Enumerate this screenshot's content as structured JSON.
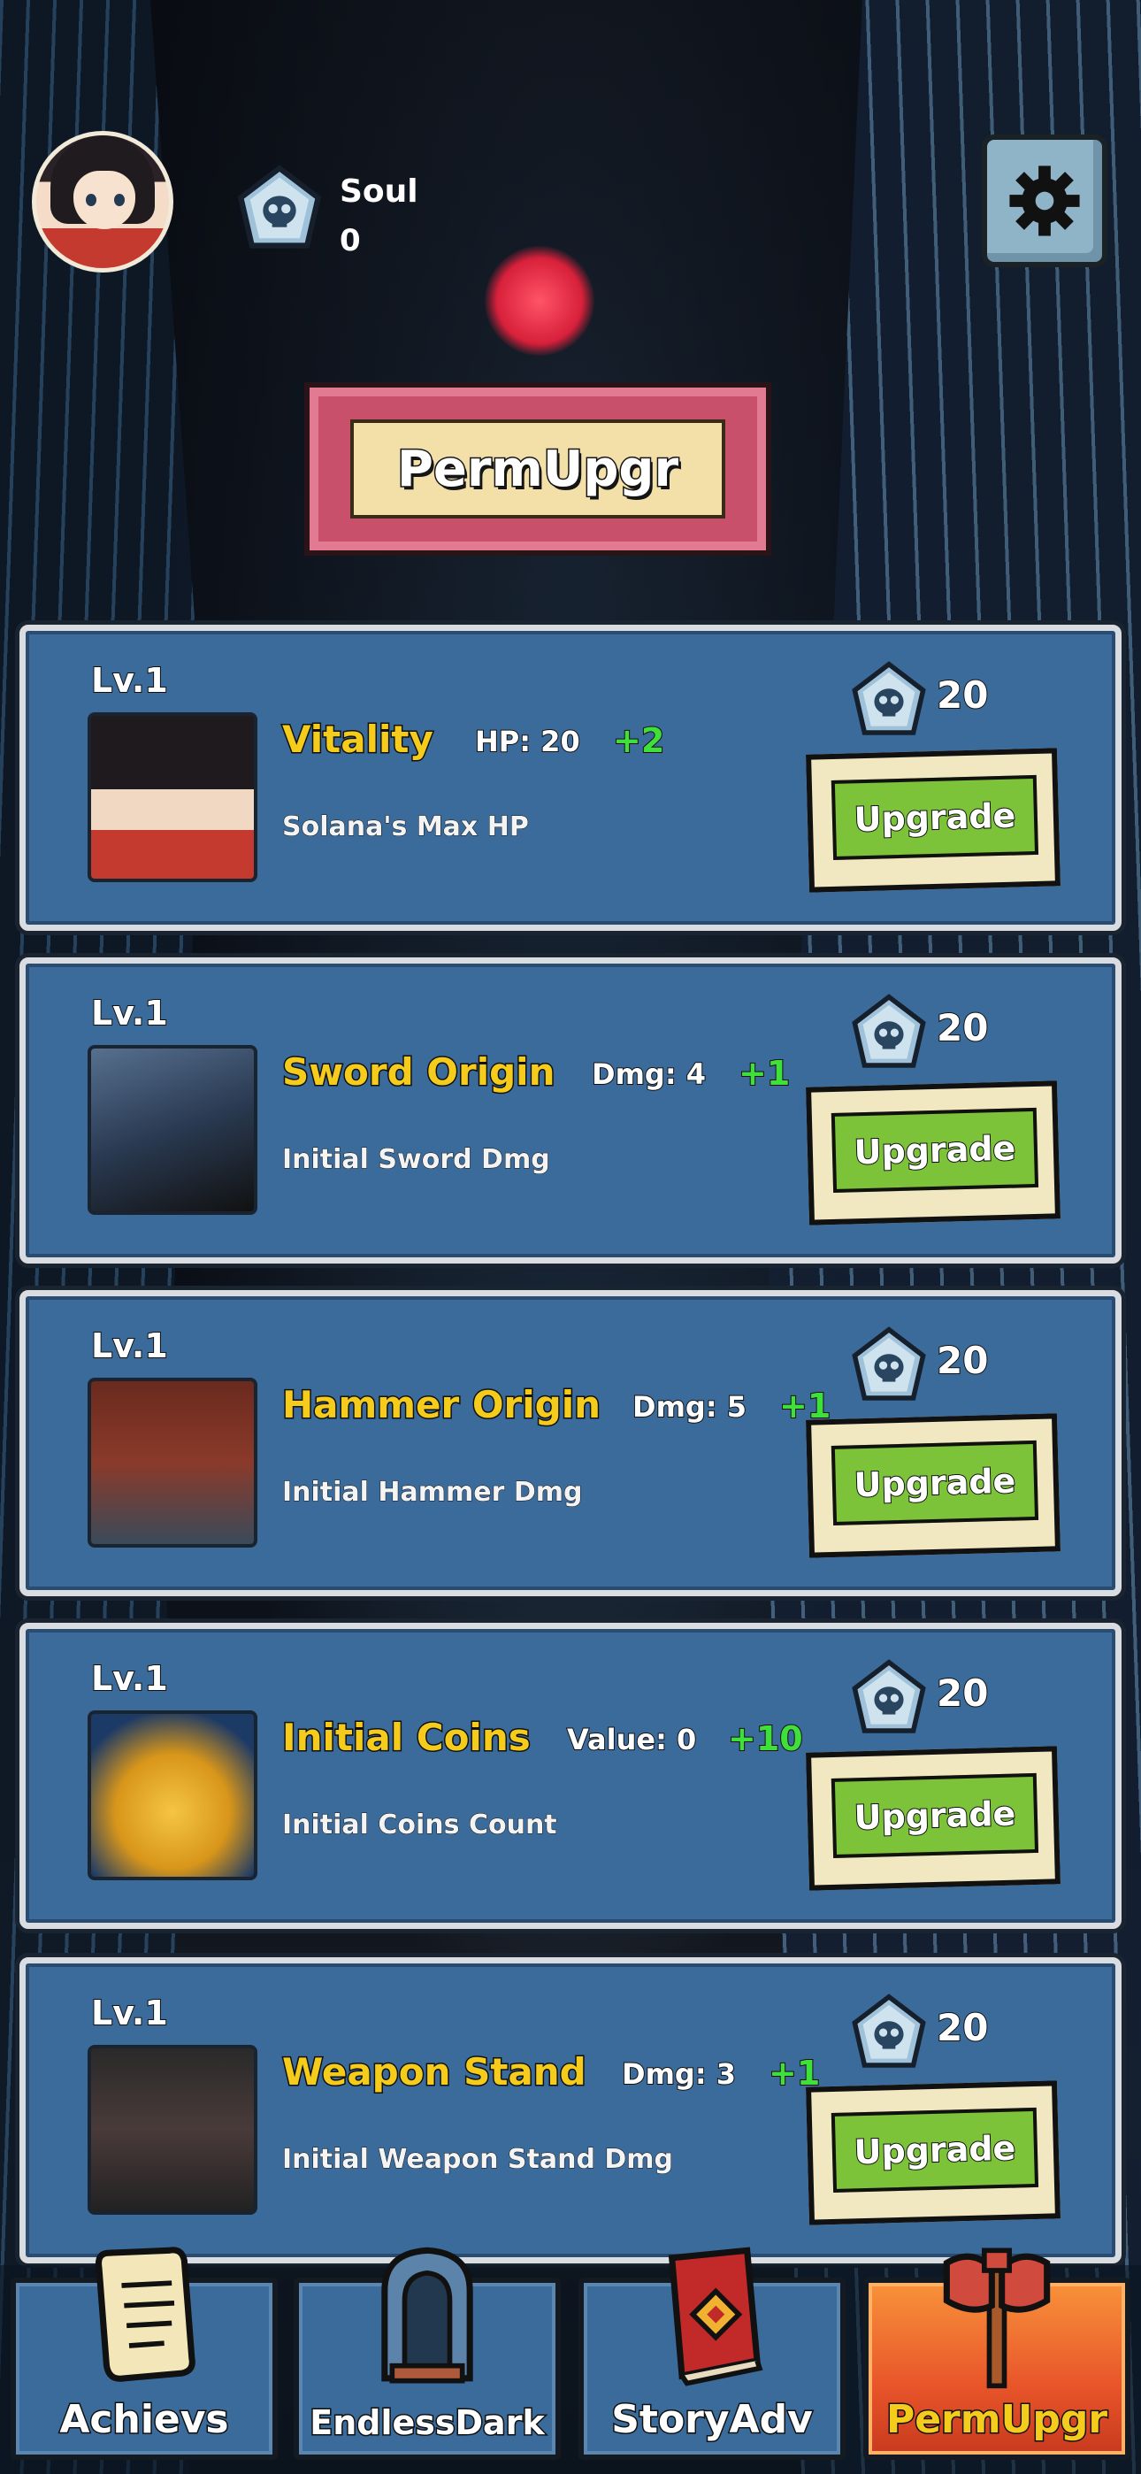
{
  "header": {
    "currency_label": "Soul",
    "currency_value": "0",
    "settings_icon": "gear-icon"
  },
  "title": "PermUpgr",
  "upgrades": [
    {
      "level": "Lv.1",
      "name": "Vitality",
      "stat": "HP: 20",
      "increment": "+2",
      "description": "Solana's Max HP",
      "cost": "20",
      "button": "Upgrade",
      "icon": "portrait-image"
    },
    {
      "level": "Lv.1",
      "name": "Sword Origin",
      "stat": "Dmg: 4",
      "increment": "+1",
      "description": "Initial Sword Dmg",
      "cost": "20",
      "button": "Upgrade",
      "icon": "sword-image"
    },
    {
      "level": "Lv.1",
      "name": "Hammer Origin",
      "stat": "Dmg: 5",
      "increment": "+1",
      "description": "Initial Hammer Dmg",
      "cost": "20",
      "button": "Upgrade",
      "icon": "hammer-image"
    },
    {
      "level": "Lv.1",
      "name": "Initial Coins",
      "stat": "Value: 0",
      "increment": "+10",
      "description": "Initial Coins Count",
      "cost": "20",
      "button": "Upgrade",
      "icon": "coins-image"
    },
    {
      "level": "Lv.1",
      "name": "Weapon Stand",
      "stat": "Dmg: 3",
      "increment": "+1",
      "description": "Initial Weapon Stand Dmg",
      "cost": "20",
      "button": "Upgrade",
      "icon": "anvil-image"
    }
  ],
  "nav": [
    {
      "label": "Achievs",
      "icon": "scroll-icon"
    },
    {
      "label": "EndlessDark",
      "icon": "gate-icon"
    },
    {
      "label": "StoryAdv",
      "icon": "book-icon"
    },
    {
      "label": "PermUpgr",
      "icon": "axe-icon",
      "active": true
    }
  ],
  "colors": {
    "card": "#3b6b9a",
    "name": "#f6cc1c",
    "increment": "#3fe03a",
    "button": "#7cc33a",
    "title_banner": "#c9506a",
    "active_tab": "#e8552a"
  }
}
